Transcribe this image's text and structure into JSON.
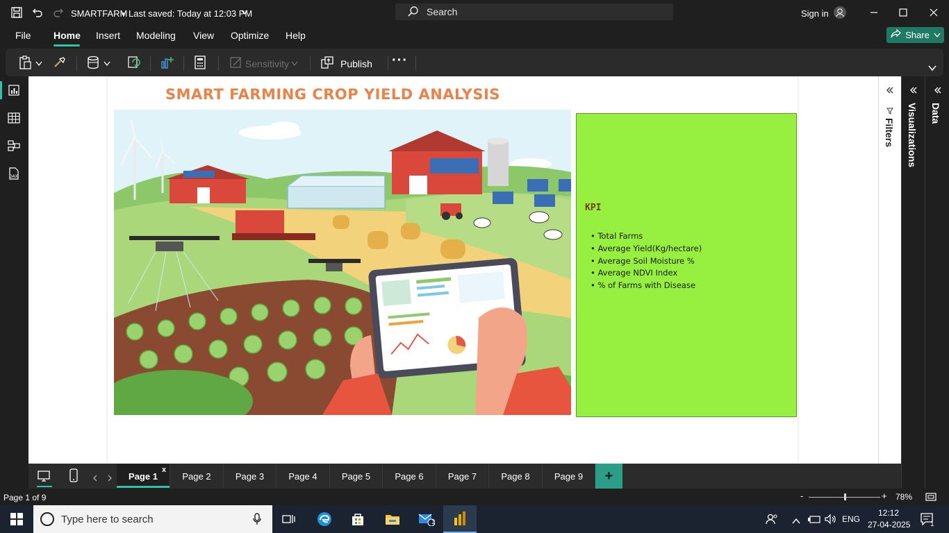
{
  "app": {
    "file_name": "SMARTFARM",
    "saved_status": "Last saved: Today at 12:03 PM",
    "search_placeholder": "Search",
    "sign_in": "Sign in",
    "share_label": "Share"
  },
  "menu": {
    "items": [
      "File",
      "Home",
      "Insert",
      "Modeling",
      "View",
      "Optimize",
      "Help"
    ],
    "active": "Home"
  },
  "ribbon": {
    "sensitivity_label": "Sensitivity",
    "publish_label": "Publish",
    "more_label": "···"
  },
  "report": {
    "title": "SMART FARMING CROP YIELD ANALYSIS",
    "kpi": {
      "heading": "KPI",
      "items": [
        "• Total Farms",
        "• Average Yield(Kg/hectare)",
        "• Average Soil Moisture %",
        "• Average NDVI Index",
        "• % of Farms with Disease"
      ]
    }
  },
  "panes": {
    "filters": "Filters",
    "visualizations": "Visualizations",
    "data": "Data"
  },
  "pages": {
    "tabs": [
      "Page 1",
      "Page 2",
      "Page 3",
      "Page 4",
      "Page 5",
      "Page 6",
      "Page 7",
      "Page 8",
      "Page 9"
    ],
    "active": "Page 1",
    "close_glyph": "x",
    "add_glyph": "+"
  },
  "status": {
    "page_indicator": "Page 1 of 9",
    "zoom_minus": "-",
    "zoom_plus": "+",
    "zoom_level": "78%",
    "zoom_fraction": 0.5
  },
  "taskbar": {
    "search_placeholder": "Type here to search",
    "language": "ENG",
    "time": "12:12",
    "date": "27-04-2025",
    "mail_badge": "1",
    "notif_badge": "1"
  },
  "colors": {
    "accent": "#2ec4a8",
    "share_bg": "#1e7a63",
    "title_orange": "#e8844a",
    "kpi_bg": "#97ef40",
    "kpi_heading": "#7a3a1a"
  }
}
